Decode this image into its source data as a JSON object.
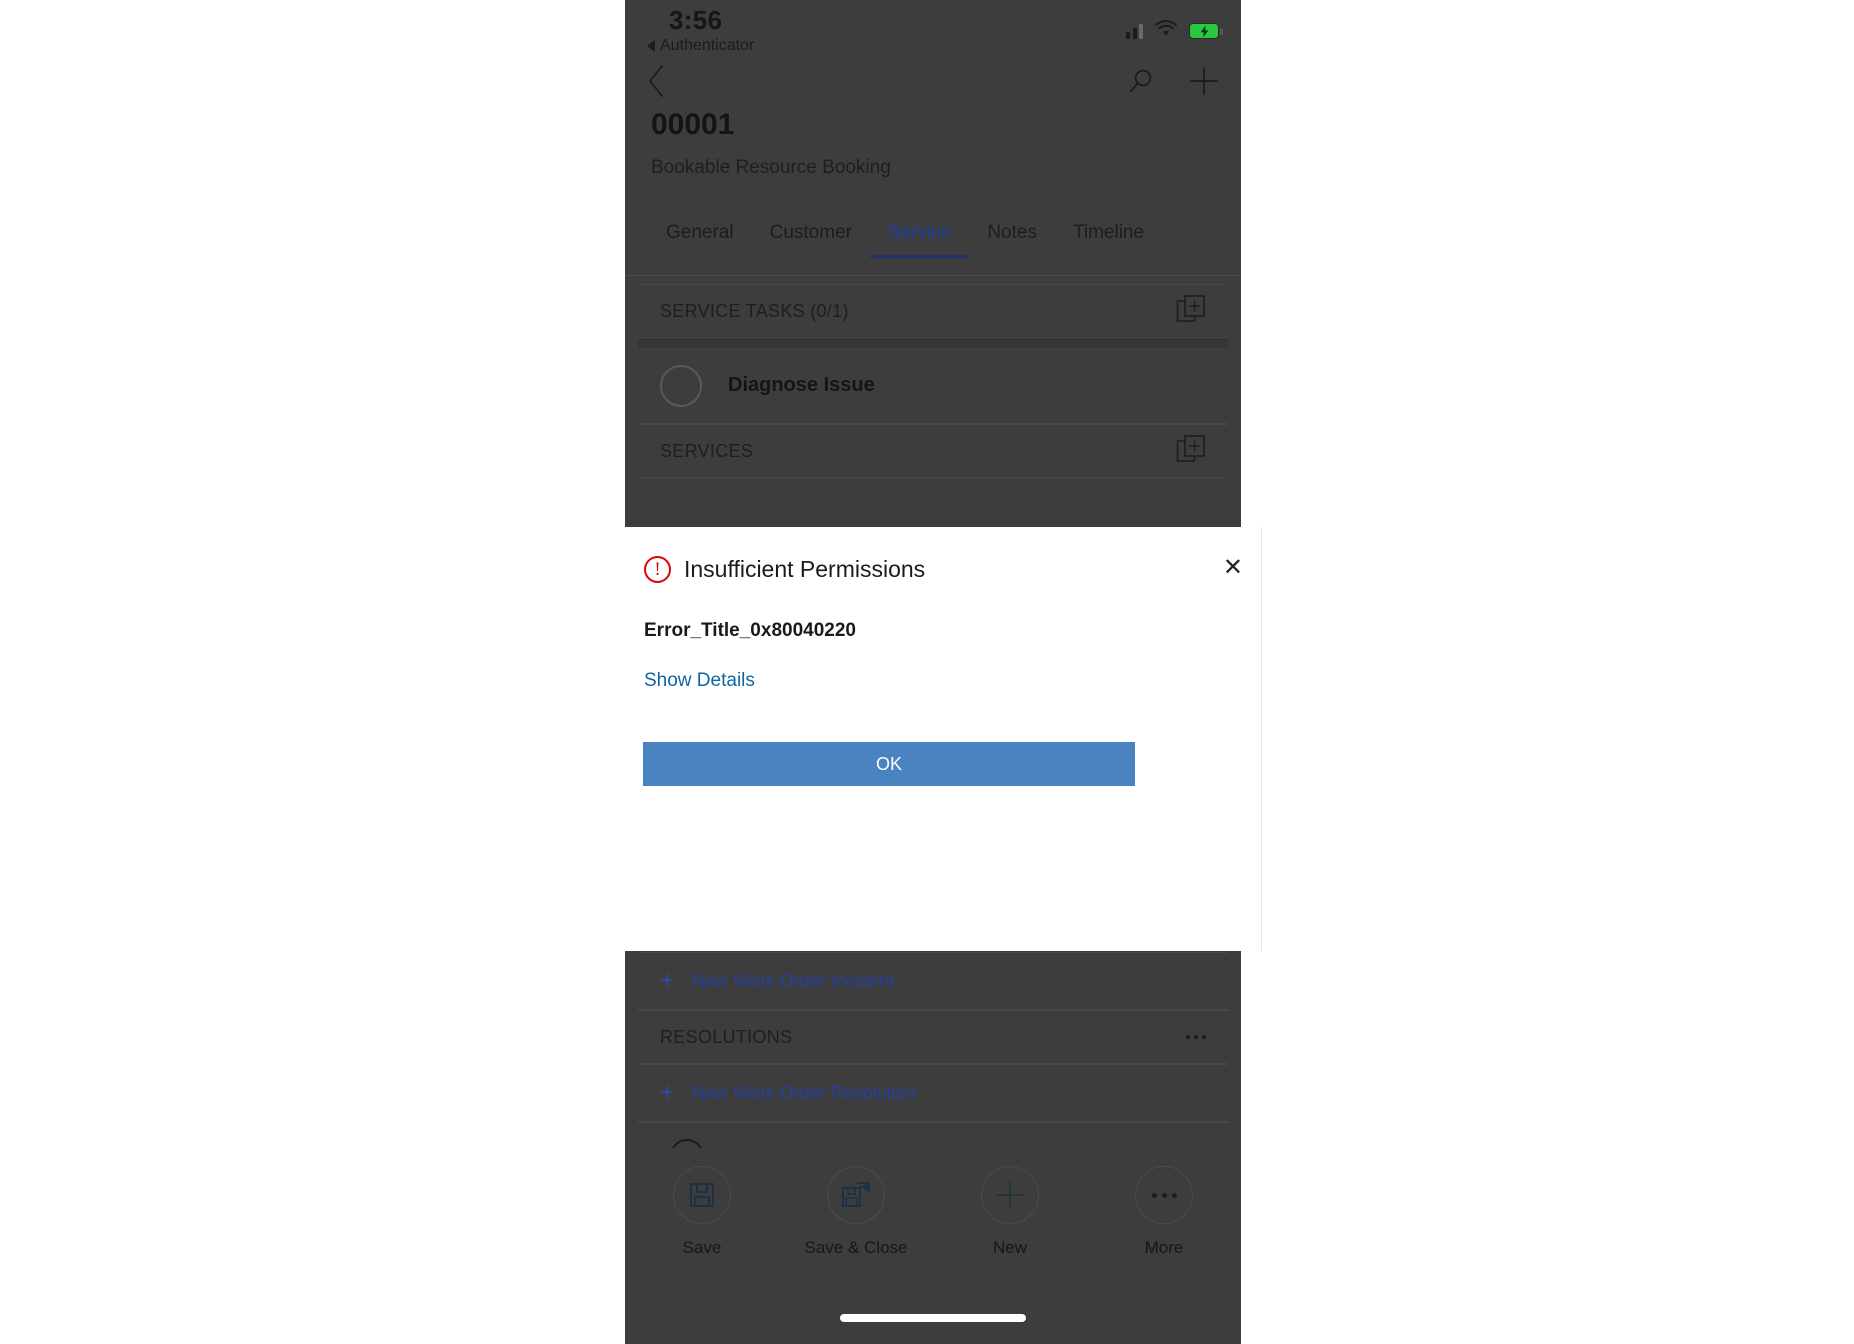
{
  "status_bar": {
    "time": "3:56",
    "back_app": "Authenticator",
    "signal_icon": "signal-bars-icon",
    "wifi_icon": "wifi-icon",
    "battery_icon": "battery-charging-icon",
    "battery_color": "#28c840"
  },
  "command_bar": {
    "back_icon": "chevron-left-icon",
    "search_icon": "search-icon",
    "add_icon": "plus-icon"
  },
  "record": {
    "id": "00001",
    "entity": "Bookable Resource Booking"
  },
  "tabs": [
    {
      "label": "General",
      "active": false
    },
    {
      "label": "Customer",
      "active": false
    },
    {
      "label": "Service",
      "active": true
    },
    {
      "label": "Notes",
      "active": false
    },
    {
      "label": "Timeline",
      "active": false
    }
  ],
  "tab_accent": "#1f3f9e",
  "sections": {
    "service_tasks": {
      "title": "SERVICE TASKS (0/1)",
      "add_icon": "add-record-icon",
      "rows": [
        {
          "label": "Diagnose Issue",
          "checkbox_icon": "circle-unchecked-icon"
        }
      ]
    },
    "services": {
      "title": "SERVICES",
      "add_icon": "add-record-icon"
    },
    "incidents": {
      "new_link": "New Work Order Incident",
      "plus_icon": "plus-icon"
    },
    "resolutions": {
      "title": "RESOLUTIONS",
      "overflow_icon": "ellipsis-icon",
      "new_link": "New Work Order Resolution",
      "plus_icon": "plus-icon"
    }
  },
  "dialog": {
    "title": "Insufficient Permissions",
    "error_icon": "error-exclamation-icon",
    "error_icon_color": "#e00000",
    "close_icon": "close-icon",
    "error_code": "Error_Title_0x80040220",
    "details_link": "Show Details",
    "ok_label": "OK",
    "ok_color": "#4a84c0",
    "link_color": "#10659e"
  },
  "bottom_bar": [
    {
      "label": "Save",
      "icon": "save-floppy-icon"
    },
    {
      "label": "Save & Close",
      "icon": "save-and-close-icon"
    },
    {
      "label": "New",
      "icon": "plus-icon"
    },
    {
      "label": "More",
      "icon": "ellipsis-icon"
    }
  ]
}
